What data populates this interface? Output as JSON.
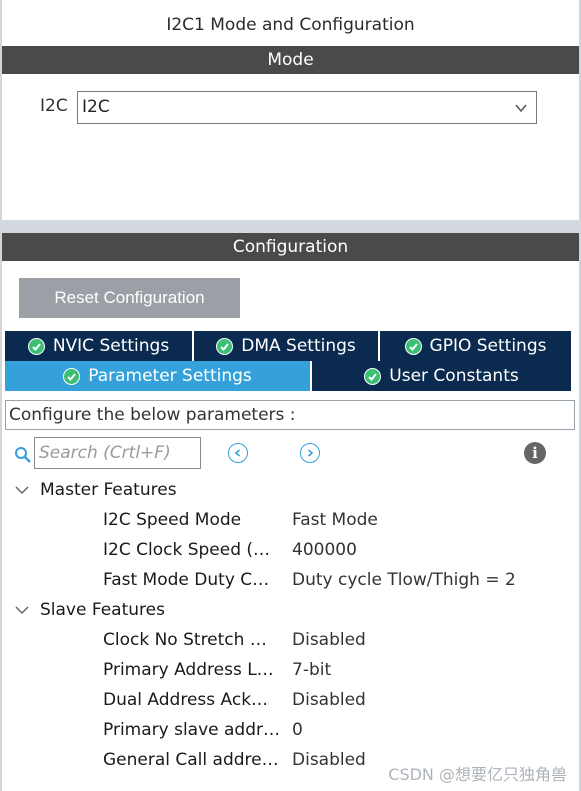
{
  "window": {
    "title": "I2C1 Mode and Configuration"
  },
  "mode": {
    "header": "Mode",
    "i2c_label": "I2C",
    "i2c_value": "I2C"
  },
  "configuration": {
    "header": "Configuration",
    "reset_label": "Reset Configuration",
    "tabs": [
      {
        "label": "NVIC Settings",
        "active": false
      },
      {
        "label": "DMA Settings",
        "active": false
      },
      {
        "label": "GPIO Settings",
        "active": false
      },
      {
        "label": "Parameter Settings",
        "active": true
      },
      {
        "label": "User Constants",
        "active": false
      }
    ],
    "description": "Configure the below parameters :",
    "search": {
      "placeholder": "Search (Crtl+F)"
    },
    "groups": [
      {
        "name": "Master Features",
        "params": [
          {
            "name": "I2C Speed Mode",
            "value": "Fast Mode"
          },
          {
            "name": "I2C Clock Speed (…",
            "value": "400000"
          },
          {
            "name": "Fast Mode Duty C…",
            "value": "Duty cycle Tlow/Thigh = 2"
          }
        ]
      },
      {
        "name": "Slave Features",
        "params": [
          {
            "name": "Clock No Stretch …",
            "value": "Disabled"
          },
          {
            "name": "Primary Address L…",
            "value": "7-bit"
          },
          {
            "name": "Dual Address Ack…",
            "value": "Disabled"
          },
          {
            "name": "Primary slave addr…",
            "value": "0"
          },
          {
            "name": "General Call addre…",
            "value": "Disabled"
          }
        ]
      }
    ]
  },
  "watermark": "CSDN @想要亿只独角兽",
  "colors": {
    "header_bg": "#4a4a4a",
    "tab_bg": "#0b2a4f",
    "tab_active_bg": "#35a1da",
    "check_green": "#3bbf73",
    "reset_bg": "#9aa0a6"
  }
}
